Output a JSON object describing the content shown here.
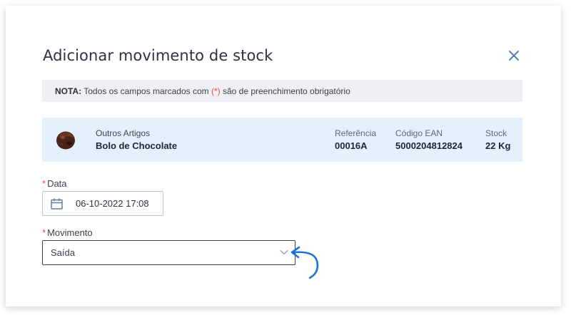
{
  "dialog": {
    "title": "Adicionar movimento de stock"
  },
  "note": {
    "prefix": "NOTA:",
    "text_before": " Todos os campos marcados com ",
    "star_marker": "(*)",
    "text_after": " são de preenchimento obrigatório"
  },
  "product": {
    "category": "Outros Artigos",
    "name": "Bolo de Chocolate",
    "reference_label": "Referência",
    "reference_value": "00016A",
    "ean_label": "Código EAN",
    "ean_value": "5000204812824",
    "stock_label": "Stock",
    "stock_value": "22 Kg"
  },
  "fields": {
    "required_marker": "*",
    "date_label": "Data",
    "date_value": "06-10-2022 17:08",
    "movement_label": "Movimento",
    "movement_value": "Saída"
  },
  "icons": {
    "close": "close-icon",
    "calendar": "calendar-icon",
    "dropdown": "chevron-down-icon",
    "annotation": "curved-arrow-icon"
  },
  "colors": {
    "required": "#e5484d",
    "note_bg": "#eef0f3",
    "product_bg": "#e4f0fb",
    "annotation_arrow": "#1a73d9"
  }
}
